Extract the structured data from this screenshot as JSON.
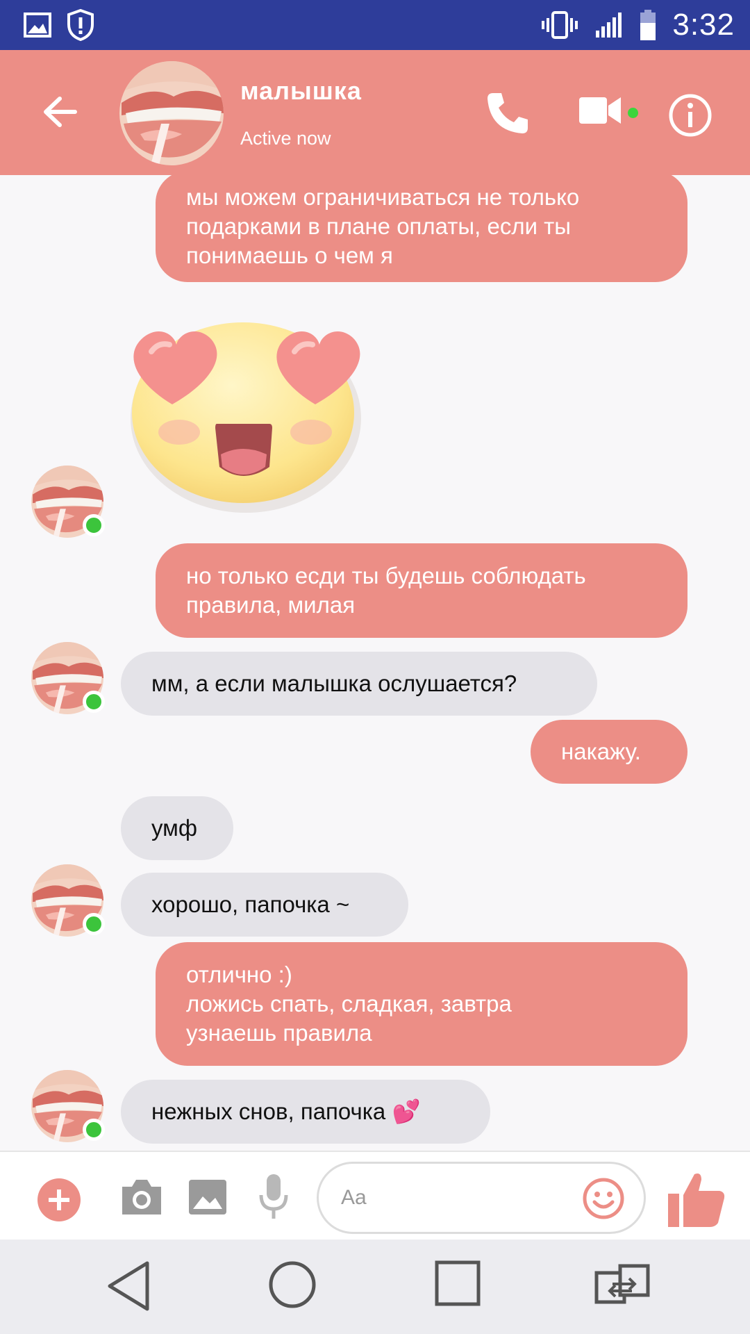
{
  "status_bar": {
    "time": "3:32",
    "icons": [
      "image-notification-icon",
      "shield-alert-icon",
      "vibrate-icon",
      "signal-icon",
      "battery-icon"
    ]
  },
  "header": {
    "contact_name": "малышка",
    "contact_status": "Active now",
    "icons": [
      "back-arrow-icon",
      "phone-icon",
      "video-icon",
      "info-icon"
    ]
  },
  "messages": [
    {
      "direction": "out",
      "lines": [
        "мы можем ограничиваться не только",
        "подарками в плане оплаты, если ты",
        "понимаешь о чем я"
      ]
    },
    {
      "direction": "in",
      "sticker": "heart-eyes-face-sticker"
    },
    {
      "direction": "out",
      "lines": [
        "но только есди ты будешь соблюдать",
        "правила, милая"
      ]
    },
    {
      "direction": "in",
      "lines": [
        "мм, а если малышка ослушается?"
      ]
    },
    {
      "direction": "out",
      "lines": [
        "накажу."
      ]
    },
    {
      "direction": "in",
      "lines": [
        "умф"
      ]
    },
    {
      "direction": "in",
      "lines": [
        "хорошо, папочка ~"
      ]
    },
    {
      "direction": "out",
      "lines": [
        "отлично :)",
        "ложись спать, сладкая, завтра",
        "узнаешь правила"
      ]
    },
    {
      "direction": "in",
      "lines": [
        "нежных снов, папочка"
      ],
      "emoji": "💕"
    }
  ],
  "composer": {
    "placeholder": "Aa",
    "icons": [
      "plus-icon",
      "camera-icon",
      "gallery-icon",
      "microphone-icon",
      "emoji-icon",
      "thumbs-up-icon"
    ]
  },
  "nav_bar": {
    "icons": [
      "nav-back-icon",
      "nav-home-icon",
      "nav-recent-icon",
      "nav-switch-icon"
    ]
  },
  "colors": {
    "status_bar": "#2e3d9a",
    "accent": "#ec8e86",
    "incoming_bubble": "#e4e3e8",
    "online": "#3cc43c"
  }
}
